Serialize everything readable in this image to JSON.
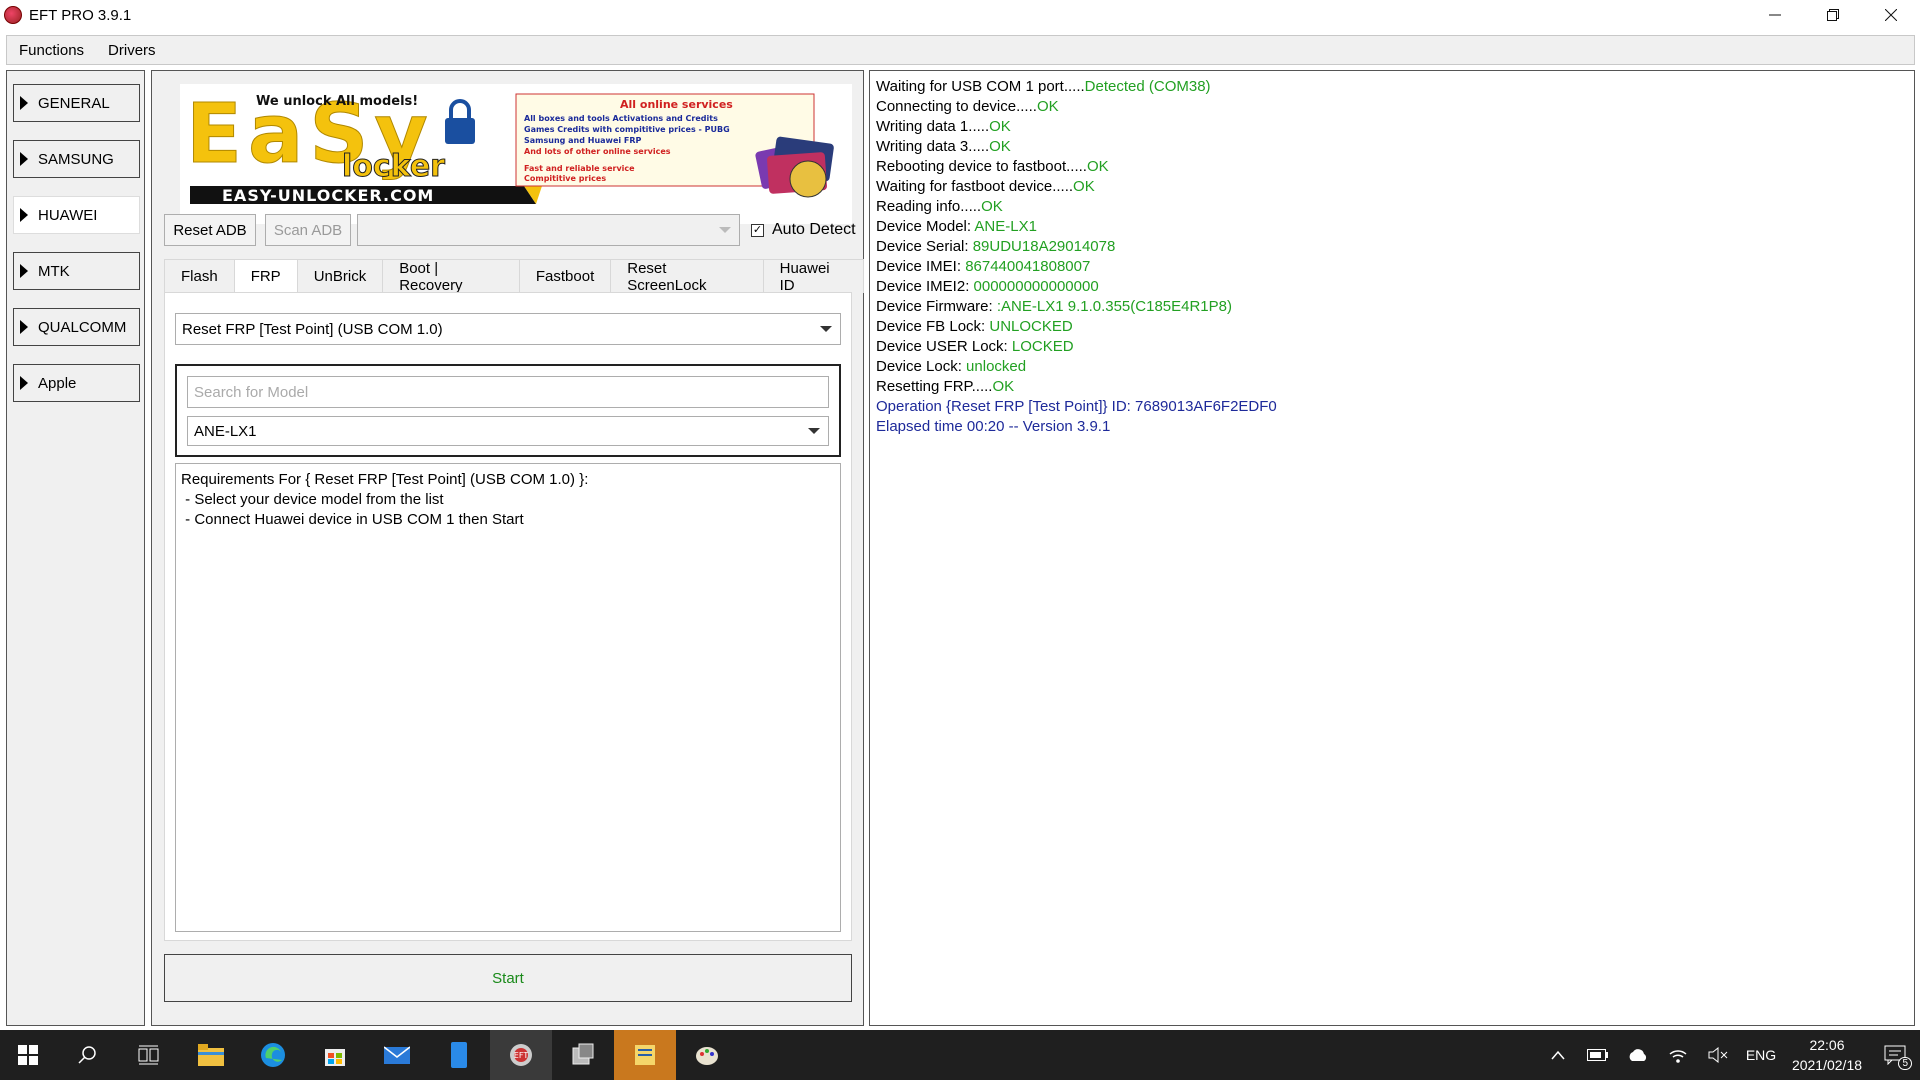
{
  "window": {
    "title": "EFT PRO 3.9.1"
  },
  "menu": [
    "Functions",
    "Drivers"
  ],
  "categories": [
    {
      "label": "GENERAL",
      "active": false
    },
    {
      "label": "SAMSUNG",
      "active": false
    },
    {
      "label": "HUAWEI",
      "active": true
    },
    {
      "label": "MTK",
      "active": false
    },
    {
      "label": "QUALCOMM",
      "active": false
    },
    {
      "label": "Apple",
      "active": false
    }
  ],
  "banner": {
    "tagline": "We unlock All models!",
    "brand_big": "EaSy",
    "brand_small": "locker",
    "website": "EASY-UNLOCKER.COM",
    "services_title": "All online services",
    "services_lines": [
      "All boxes and tools Activations and Credits",
      "Games Credits with compititive prices - PUBG",
      "Samsung and Huawei FRP",
      "And lots of other online services"
    ],
    "services_footer": [
      "Fast and reliable service",
      "Compititive prices"
    ]
  },
  "adb": {
    "reset_label": "Reset ADB",
    "scan_label": "Scan ADB",
    "port_value": "",
    "auto_detect_label": "Auto Detect",
    "auto_detect_checked": true
  },
  "tabs": [
    {
      "label": "Flash",
      "active": false
    },
    {
      "label": "FRP",
      "active": true
    },
    {
      "label": "UnBrick",
      "active": false
    },
    {
      "label": "Boot | Recovery",
      "active": false
    },
    {
      "label": "Fastboot",
      "active": false
    },
    {
      "label": "Reset ScreenLock",
      "active": false
    },
    {
      "label": "Huawei ID",
      "active": false
    }
  ],
  "frp": {
    "operation": "Reset FRP [Test Point] (USB COM 1.0)",
    "search_placeholder": "Search for Model",
    "model": "ANE-LX1",
    "requirements": [
      "Requirements For { Reset FRP [Test Point] (USB COM 1.0) }:",
      " - Select your device model from the list",
      " - Connect Huawei device in USB COM 1 then Start"
    ],
    "start_label": "Start"
  },
  "log": [
    {
      "label": "Waiting for USB COM 1 port.....",
      "value": "Detected (COM38)",
      "type": "kv"
    },
    {
      "label": "Connecting to device.....",
      "value": "OK",
      "type": "kv"
    },
    {
      "label": "Writing data 1.....",
      "value": "OK",
      "type": "kv"
    },
    {
      "label": "Writing data 3.....",
      "value": "OK",
      "type": "kv"
    },
    {
      "label": "Rebooting device to fastboot.....",
      "value": "OK",
      "type": "kv"
    },
    {
      "label": "Waiting for fastboot device.....",
      "value": "OK",
      "type": "kv"
    },
    {
      "label": "Reading info.....",
      "value": "OK",
      "type": "kv"
    },
    {
      "label": "Device Model: ",
      "value": "ANE-LX1",
      "type": "kv"
    },
    {
      "label": "Device Serial: ",
      "value": "89UDU18A29014078",
      "type": "kv"
    },
    {
      "label": "Device IMEI: ",
      "value": "867440041808007",
      "type": "kv"
    },
    {
      "label": "Device IMEI2: ",
      "value": "000000000000000",
      "type": "kv"
    },
    {
      "label": "Device Firmware: ",
      "value": ":ANE-LX1 9.1.0.355(C185E4R1P8)",
      "type": "kv"
    },
    {
      "label": "Device FB Lock: ",
      "value": "UNLOCKED",
      "type": "kv"
    },
    {
      "label": "Device USER Lock: ",
      "value": "LOCKED",
      "type": "kv"
    },
    {
      "label": "Device Lock: ",
      "value": "unlocked",
      "type": "kv"
    },
    {
      "label": "Resetting FRP.....",
      "value": "OK",
      "type": "kv"
    },
    {
      "label": "Operation {Reset FRP [Test Point]} ID: 7689013AF6F2EDF0",
      "value": "",
      "type": "info"
    },
    {
      "label": "Elapsed time 00:20 -- Version 3.9.1",
      "value": "",
      "type": "info"
    }
  ],
  "taskbar": {
    "apps": [
      "start-icon",
      "search-icon",
      "task-view-icon",
      "file-explorer-icon",
      "edge-icon",
      "store-icon",
      "mail-icon",
      "phone-app-icon",
      "eft-app-icon",
      "tool-app-icon",
      "notes-app-icon",
      "paint-app-icon"
    ],
    "language": "ENG",
    "time": "22:06",
    "date": "2021/02/18",
    "notification_count": "5"
  },
  "colors": {
    "log_ok": "#22a022",
    "log_info": "#1e2a9a",
    "start_text": "#1a8a1a"
  }
}
